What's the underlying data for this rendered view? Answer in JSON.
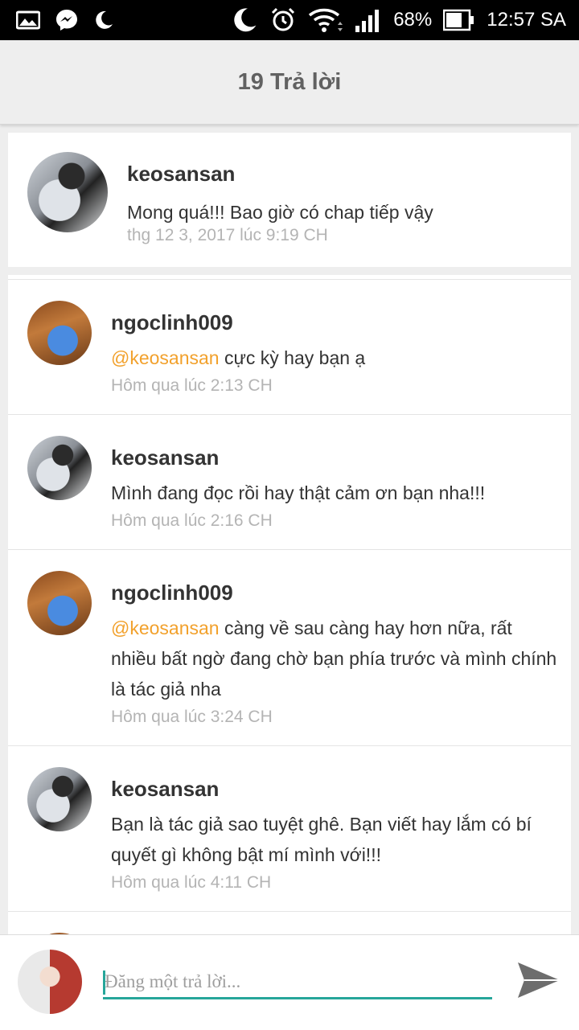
{
  "status_bar": {
    "battery": "68%",
    "time": "12:57 SA",
    "icons_left": [
      "gallery-icon",
      "messenger-icon",
      "moon-icon"
    ],
    "icons_right": [
      "moon-icon",
      "alarm-icon",
      "wifi-icon",
      "signal-icon",
      "battery-icon"
    ]
  },
  "header": {
    "title": "19 Trả lời"
  },
  "main_comment": {
    "username": "keosansan",
    "message": "Mong quá!!!  Bao giờ có chap tiếp vậy",
    "timestamp": "thg 12 3, 2017 lúc 9:19 CH"
  },
  "replies": [
    {
      "username": "ngoclinh009",
      "mention": "@keosansan",
      "message": " cực kỳ hay bạn ạ",
      "timestamp": "Hôm qua lúc 2:13 CH"
    },
    {
      "username": "keosansan",
      "mention": "",
      "message": "Mình đang đọc rồi hay thật cảm ơn bạn nha!!!",
      "timestamp": "Hôm qua lúc 2:16 CH"
    },
    {
      "username": "ngoclinh009",
      "mention": "@keosansan",
      "message": " càng về sau càng hay hơn nữa, rất nhiều bất ngờ đang chờ bạn phía trước       và mình chính là tác giả nha",
      "timestamp": "Hôm qua lúc 3:24 CH"
    },
    {
      "username": "keosansan",
      "mention": "",
      "message": "Bạn là tác giả sao tuyệt ghê. Bạn viết hay lắm có bí quyết gì không bật mí mình với!!!",
      "timestamp": "Hôm qua lúc 4:11 CH"
    }
  ],
  "reply_input": {
    "placeholder": "Đăng một trả lời..."
  },
  "colors": {
    "accent": "#26a69a",
    "mention": "#f2a12c",
    "timestamp": "#b4b4b4"
  }
}
